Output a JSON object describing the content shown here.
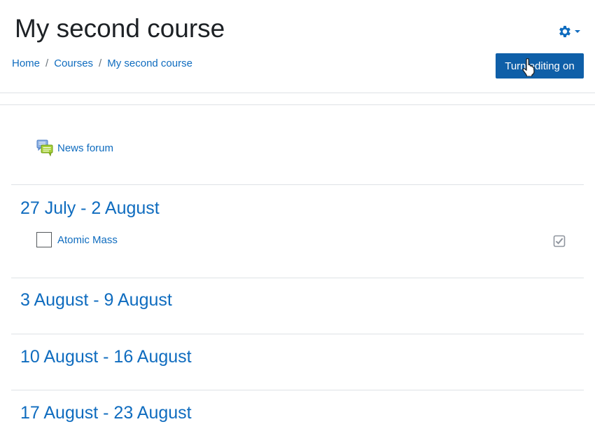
{
  "header": {
    "title": "My second course",
    "edit_button_label": "Turn editing on",
    "settings_icon": "gear-icon"
  },
  "breadcrumb": {
    "items": [
      "Home",
      "Courses",
      "My second course"
    ],
    "separator": "/"
  },
  "top_section": {
    "activities": [
      {
        "name": "News forum",
        "icon": "forum-icon"
      }
    ]
  },
  "sections": [
    {
      "title": "27 July - 2 August",
      "activities": [
        {
          "name": "Atomic Mass",
          "icon": "blank-activity-icon",
          "completion": "manual-completion-checkbox"
        }
      ]
    },
    {
      "title": "3 August - 9 August"
    },
    {
      "title": "10 August - 16 August"
    },
    {
      "title": "17 August - 23 August"
    }
  ],
  "colors": {
    "link": "#0f6cbf",
    "button_bg": "#0f5fa8",
    "text": "#1d2125",
    "rule": "#dee2e6"
  }
}
